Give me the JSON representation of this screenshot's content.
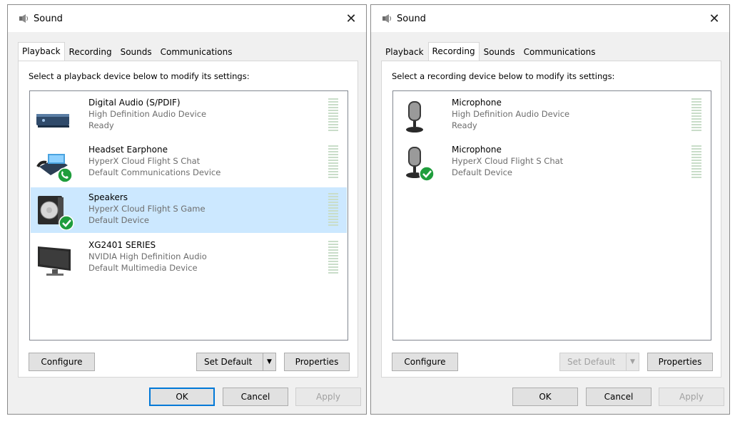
{
  "left": {
    "title": "Sound",
    "close": "✕",
    "tabs": [
      "Playback",
      "Recording",
      "Sounds",
      "Communications"
    ],
    "active_tab": 0,
    "instruction": "Select a playback device below to modify its settings:",
    "devices": [
      {
        "name": "Digital Audio (S/PDIF)",
        "line1": "High Definition Audio Device",
        "line2": "Ready",
        "icon": "spdif-device-icon",
        "status": "none",
        "selected": false
      },
      {
        "name": "Headset Earphone",
        "line1": "HyperX Cloud Flight S Chat",
        "line2": "Default Communications Device",
        "icon": "headset-phone-icon",
        "status": "phone",
        "selected": false
      },
      {
        "name": "Speakers",
        "line1": "HyperX Cloud Flight S Game",
        "line2": "Default Device",
        "icon": "speaker-icon",
        "status": "check",
        "selected": true
      },
      {
        "name": "XG2401 SERIES",
        "line1": "NVIDIA High Definition Audio",
        "line2": "Default Multimedia Device",
        "icon": "monitor-icon",
        "status": "none",
        "selected": false
      }
    ],
    "buttons": {
      "configure": "Configure",
      "set_default": "Set Default",
      "properties": "Properties",
      "ok": "OK",
      "cancel": "Cancel",
      "apply": "Apply"
    }
  },
  "right": {
    "title": "Sound",
    "close": "✕",
    "tabs": [
      "Playback",
      "Recording",
      "Sounds",
      "Communications"
    ],
    "active_tab": 1,
    "instruction": "Select a recording device below to modify its settings:",
    "devices": [
      {
        "name": "Microphone",
        "line1": "High Definition Audio Device",
        "line2": "Ready",
        "icon": "microphone-icon",
        "status": "none",
        "selected": false
      },
      {
        "name": "Microphone",
        "line1": "HyperX Cloud Flight S Chat",
        "line2": "Default Device",
        "icon": "microphone-icon",
        "status": "check",
        "selected": false
      }
    ],
    "buttons": {
      "configure": "Configure",
      "set_default": "Set Default",
      "properties": "Properties",
      "ok": "OK",
      "cancel": "Cancel",
      "apply": "Apply"
    }
  },
  "colors": {
    "selection": "#cce8ff",
    "check_green": "#1f9d3c",
    "accent": "#0078d7"
  }
}
